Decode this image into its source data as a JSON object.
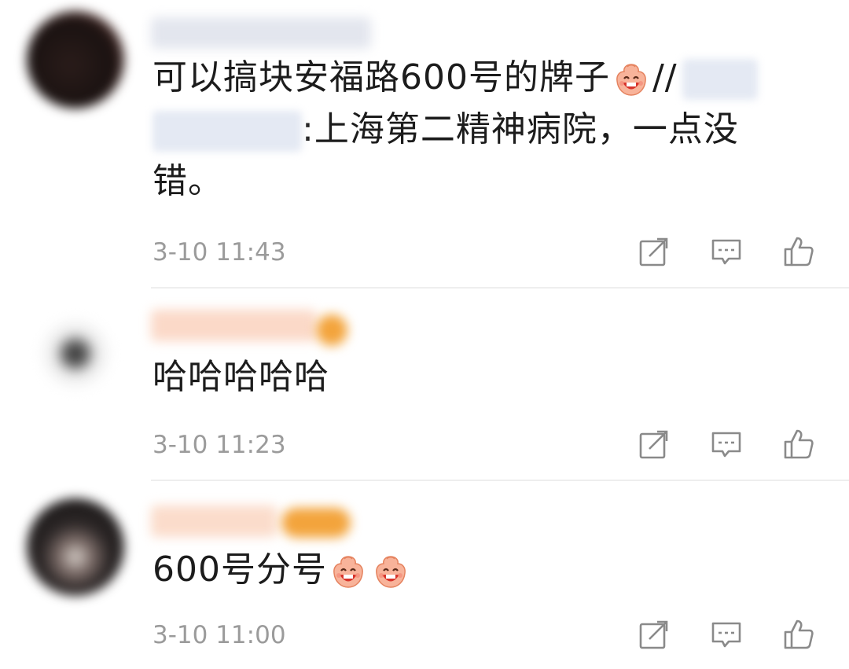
{
  "comments": [
    {
      "text_before_emoji": "可以搞块安福路600号的牌子",
      "after_emoji": "//",
      "line2": ":上海第二精神病院，一点没",
      "line3": "错。",
      "time": "3-10 11:43",
      "emoji": "laughing-face-emoji"
    },
    {
      "text": "哈哈哈哈哈",
      "time": "3-10 11:23"
    },
    {
      "text": "600号分号",
      "time": "3-10 11:00",
      "emoji": "laughing-face-emoji"
    }
  ],
  "colors": {
    "text": "#1c1c1c",
    "time": "#9b9b9b",
    "icon": "#8a8a8a",
    "divider": "#eeeeee",
    "emoji": "#f6a07a"
  },
  "icons": [
    "forward-icon",
    "comment-icon",
    "like-icon"
  ]
}
